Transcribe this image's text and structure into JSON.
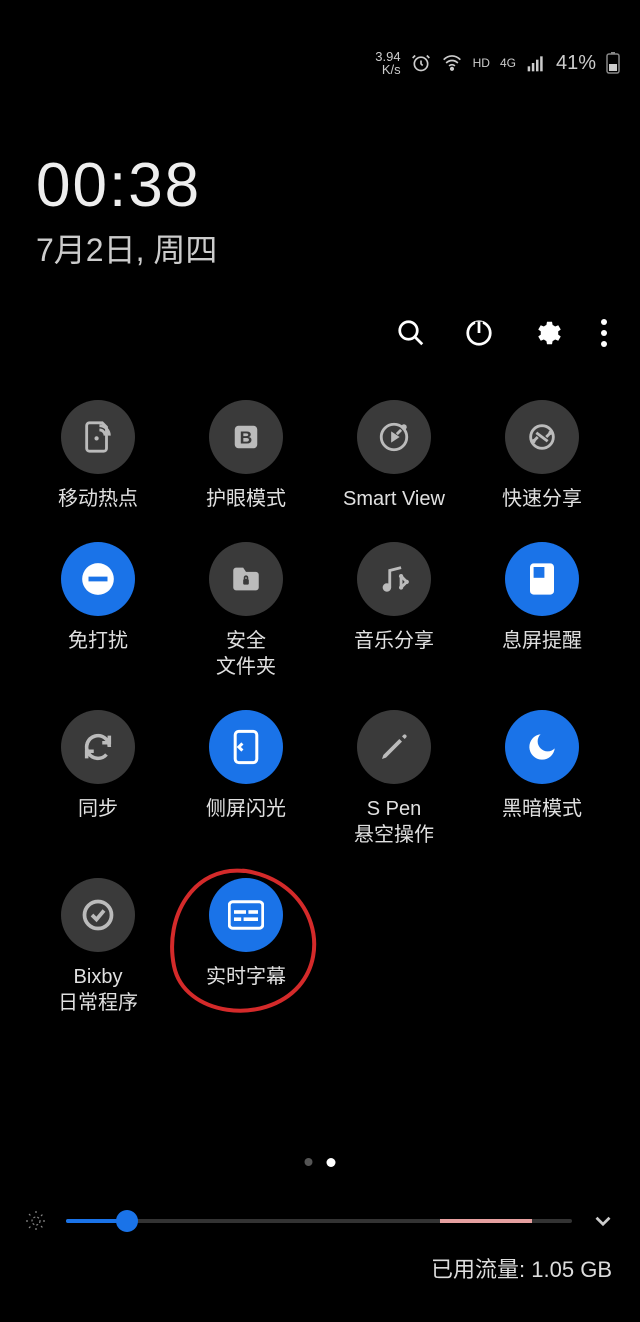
{
  "status": {
    "speed_value": "3.94",
    "speed_unit": "K/s",
    "hd": "HD",
    "net": "4G",
    "battery_text": "41%"
  },
  "clock": {
    "time": "00:38",
    "date": "7月2日, 周四"
  },
  "actions": {
    "search": "search",
    "power": "power",
    "settings": "settings",
    "more": "more"
  },
  "tiles": [
    {
      "id": "hotspot",
      "label": "移动热点",
      "on": false,
      "icon": "hotspot"
    },
    {
      "id": "eye-comfort",
      "label": "护眼模式",
      "on": false,
      "icon": "eye-b"
    },
    {
      "id": "smart-view",
      "label": "Smart View",
      "on": false,
      "icon": "cast"
    },
    {
      "id": "quick-share",
      "label": "快速分享",
      "on": false,
      "icon": "quick-share"
    },
    {
      "id": "dnd",
      "label": "免打扰",
      "on": true,
      "icon": "dnd"
    },
    {
      "id": "secure-folder",
      "label": "安全\n文件夹",
      "on": false,
      "icon": "folder-lock"
    },
    {
      "id": "music-share",
      "label": "音乐分享",
      "on": false,
      "icon": "music-share"
    },
    {
      "id": "aod",
      "label": "息屏提醒",
      "on": true,
      "icon": "aod"
    },
    {
      "id": "sync",
      "label": "同步",
      "on": false,
      "icon": "sync"
    },
    {
      "id": "edge-lighting",
      "label": "侧屏闪光",
      "on": true,
      "icon": "edge"
    },
    {
      "id": "s-pen",
      "label": "S Pen\n悬空操作",
      "on": false,
      "icon": "pen"
    },
    {
      "id": "dark-mode",
      "label": "黑暗模式",
      "on": true,
      "icon": "moon"
    },
    {
      "id": "bixby-routine",
      "label": "Bixby\n日常程序",
      "on": false,
      "icon": "routine"
    },
    {
      "id": "live-caption",
      "label": "实时字幕",
      "on": true,
      "icon": "caption",
      "annotated": true
    }
  ],
  "pager": {
    "current": 2,
    "total": 2
  },
  "brightness": {
    "value_pct": 12
  },
  "footer": {
    "data_usage_label": "已用流量:",
    "data_usage_value": "1.05 GB"
  }
}
